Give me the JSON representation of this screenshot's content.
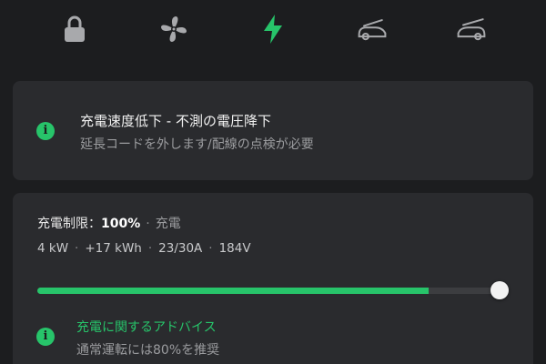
{
  "top_tabs": [
    {
      "icon": "lock-icon",
      "active": false
    },
    {
      "icon": "fan-icon",
      "active": false
    },
    {
      "icon": "lightning-icon",
      "active": true
    },
    {
      "icon": "frunk-icon",
      "active": false
    },
    {
      "icon": "trunk-icon",
      "active": false
    }
  ],
  "colors": {
    "background": "#1c1d1f",
    "card": "#2a2b2e",
    "accent_green": "#27c46a",
    "icon_inactive": "#a8a9ac",
    "text_muted": "#9b9c9f"
  },
  "alert": {
    "title": "充電速度低下 - 不測の電圧降下",
    "subtitle": "延長コードを外します/配線の点検が必要",
    "icon_glyph": "i"
  },
  "charge": {
    "limit_label": "充電制限：",
    "limit_value": "100%",
    "separator": "·",
    "status": "充電",
    "power": "4 kW",
    "energy_added": "+17 kWh",
    "current": "23/30A",
    "voltage": "184V",
    "battery_level_percent": 83,
    "limit_percent": 100
  },
  "advice": {
    "title": "充電に関するアドバイス",
    "subtitle": "通常運転には80%を推奨",
    "icon_glyph": "i"
  }
}
